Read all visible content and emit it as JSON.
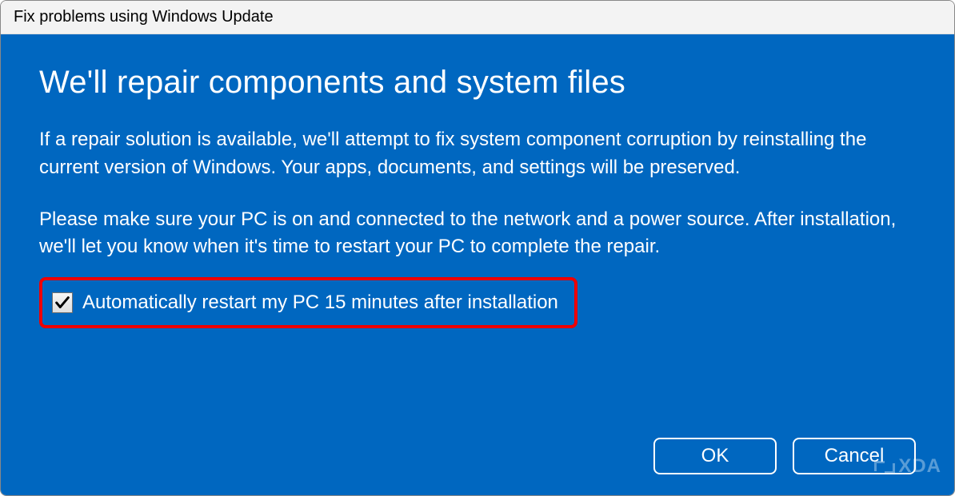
{
  "window": {
    "title": "Fix problems using Windows Update"
  },
  "content": {
    "heading": "We'll repair components and system files",
    "description": "If a repair solution is available, we'll attempt to fix system component corruption by reinstalling the current version of Windows. Your apps, documents, and settings will be preserved.",
    "note": "Please make sure your PC is on and connected to the network and a power source. After installation, we'll let you know when it's time to restart your PC to complete the repair."
  },
  "checkbox": {
    "label": "Automatically restart my PC 15 minutes after installation",
    "checked": true
  },
  "buttons": {
    "ok": "OK",
    "cancel": "Cancel"
  },
  "watermark": {
    "text": "XDA"
  }
}
